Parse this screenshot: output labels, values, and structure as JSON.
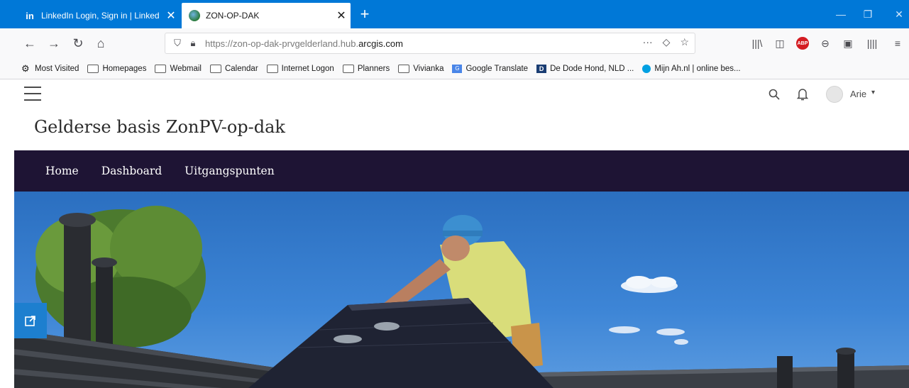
{
  "browser": {
    "tabs": [
      {
        "title": "LinkedIn Login, Sign in | Linked",
        "favicon": "linkedin-icon",
        "active": false
      },
      {
        "title": "ZON-OP-DAK",
        "favicon": "globe-icon",
        "active": true
      }
    ],
    "url_prefix": "https://zon-op-dak-prvgelderland.hub.",
    "url_domain": "arcgis.com",
    "url_more": "···",
    "bookmarks": [
      {
        "label": "Most Visited",
        "icon": "gear-icon"
      },
      {
        "label": "Homepages",
        "icon": "folder-icon"
      },
      {
        "label": "Webmail",
        "icon": "folder-icon"
      },
      {
        "label": "Calendar",
        "icon": "folder-icon"
      },
      {
        "label": "Internet Logon",
        "icon": "folder-icon"
      },
      {
        "label": "Planners",
        "icon": "folder-icon"
      },
      {
        "label": "Vivianka",
        "icon": "folder-icon"
      },
      {
        "label": "Google Translate",
        "icon": "google-translate-icon"
      },
      {
        "label": "De Dode Hond, NLD ...",
        "icon": "dode-hond-icon"
      },
      {
        "label": "Mijn Ah.nl | online bes...",
        "icon": "ah-icon"
      }
    ],
    "abp_label": "ABP",
    "colors": {
      "tabstrip": "#0078d7",
      "toolbar": "#f9f9fa"
    }
  },
  "site": {
    "title": "Gelderse basis ZonPV-op-dak",
    "user": "Arie",
    "nav": [
      "Home",
      "Dashboard",
      "Uitgangspunten"
    ],
    "colors": {
      "nav_bg": "#1e1434",
      "share_button": "#1d7fcf"
    }
  }
}
